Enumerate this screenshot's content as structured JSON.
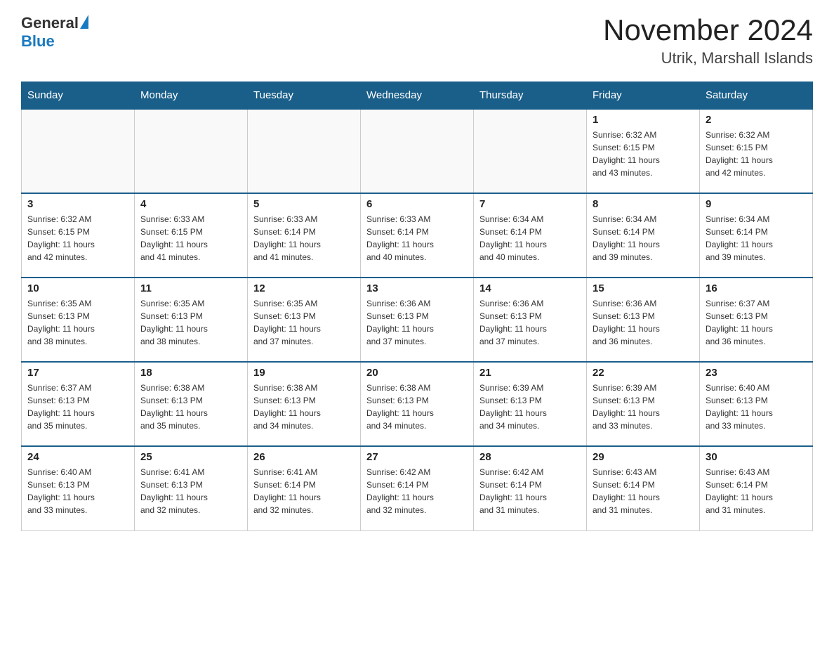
{
  "header": {
    "logo_general": "General",
    "logo_blue": "Blue",
    "title": "November 2024",
    "subtitle": "Utrik, Marshall Islands"
  },
  "days_of_week": [
    "Sunday",
    "Monday",
    "Tuesday",
    "Wednesday",
    "Thursday",
    "Friday",
    "Saturday"
  ],
  "weeks": [
    [
      {
        "day": "",
        "info": ""
      },
      {
        "day": "",
        "info": ""
      },
      {
        "day": "",
        "info": ""
      },
      {
        "day": "",
        "info": ""
      },
      {
        "day": "",
        "info": ""
      },
      {
        "day": "1",
        "info": "Sunrise: 6:32 AM\nSunset: 6:15 PM\nDaylight: 11 hours\nand 43 minutes."
      },
      {
        "day": "2",
        "info": "Sunrise: 6:32 AM\nSunset: 6:15 PM\nDaylight: 11 hours\nand 42 minutes."
      }
    ],
    [
      {
        "day": "3",
        "info": "Sunrise: 6:32 AM\nSunset: 6:15 PM\nDaylight: 11 hours\nand 42 minutes."
      },
      {
        "day": "4",
        "info": "Sunrise: 6:33 AM\nSunset: 6:15 PM\nDaylight: 11 hours\nand 41 minutes."
      },
      {
        "day": "5",
        "info": "Sunrise: 6:33 AM\nSunset: 6:14 PM\nDaylight: 11 hours\nand 41 minutes."
      },
      {
        "day": "6",
        "info": "Sunrise: 6:33 AM\nSunset: 6:14 PM\nDaylight: 11 hours\nand 40 minutes."
      },
      {
        "day": "7",
        "info": "Sunrise: 6:34 AM\nSunset: 6:14 PM\nDaylight: 11 hours\nand 40 minutes."
      },
      {
        "day": "8",
        "info": "Sunrise: 6:34 AM\nSunset: 6:14 PM\nDaylight: 11 hours\nand 39 minutes."
      },
      {
        "day": "9",
        "info": "Sunrise: 6:34 AM\nSunset: 6:14 PM\nDaylight: 11 hours\nand 39 minutes."
      }
    ],
    [
      {
        "day": "10",
        "info": "Sunrise: 6:35 AM\nSunset: 6:13 PM\nDaylight: 11 hours\nand 38 minutes."
      },
      {
        "day": "11",
        "info": "Sunrise: 6:35 AM\nSunset: 6:13 PM\nDaylight: 11 hours\nand 38 minutes."
      },
      {
        "day": "12",
        "info": "Sunrise: 6:35 AM\nSunset: 6:13 PM\nDaylight: 11 hours\nand 37 minutes."
      },
      {
        "day": "13",
        "info": "Sunrise: 6:36 AM\nSunset: 6:13 PM\nDaylight: 11 hours\nand 37 minutes."
      },
      {
        "day": "14",
        "info": "Sunrise: 6:36 AM\nSunset: 6:13 PM\nDaylight: 11 hours\nand 37 minutes."
      },
      {
        "day": "15",
        "info": "Sunrise: 6:36 AM\nSunset: 6:13 PM\nDaylight: 11 hours\nand 36 minutes."
      },
      {
        "day": "16",
        "info": "Sunrise: 6:37 AM\nSunset: 6:13 PM\nDaylight: 11 hours\nand 36 minutes."
      }
    ],
    [
      {
        "day": "17",
        "info": "Sunrise: 6:37 AM\nSunset: 6:13 PM\nDaylight: 11 hours\nand 35 minutes."
      },
      {
        "day": "18",
        "info": "Sunrise: 6:38 AM\nSunset: 6:13 PM\nDaylight: 11 hours\nand 35 minutes."
      },
      {
        "day": "19",
        "info": "Sunrise: 6:38 AM\nSunset: 6:13 PM\nDaylight: 11 hours\nand 34 minutes."
      },
      {
        "day": "20",
        "info": "Sunrise: 6:38 AM\nSunset: 6:13 PM\nDaylight: 11 hours\nand 34 minutes."
      },
      {
        "day": "21",
        "info": "Sunrise: 6:39 AM\nSunset: 6:13 PM\nDaylight: 11 hours\nand 34 minutes."
      },
      {
        "day": "22",
        "info": "Sunrise: 6:39 AM\nSunset: 6:13 PM\nDaylight: 11 hours\nand 33 minutes."
      },
      {
        "day": "23",
        "info": "Sunrise: 6:40 AM\nSunset: 6:13 PM\nDaylight: 11 hours\nand 33 minutes."
      }
    ],
    [
      {
        "day": "24",
        "info": "Sunrise: 6:40 AM\nSunset: 6:13 PM\nDaylight: 11 hours\nand 33 minutes."
      },
      {
        "day": "25",
        "info": "Sunrise: 6:41 AM\nSunset: 6:13 PM\nDaylight: 11 hours\nand 32 minutes."
      },
      {
        "day": "26",
        "info": "Sunrise: 6:41 AM\nSunset: 6:14 PM\nDaylight: 11 hours\nand 32 minutes."
      },
      {
        "day": "27",
        "info": "Sunrise: 6:42 AM\nSunset: 6:14 PM\nDaylight: 11 hours\nand 32 minutes."
      },
      {
        "day": "28",
        "info": "Sunrise: 6:42 AM\nSunset: 6:14 PM\nDaylight: 11 hours\nand 31 minutes."
      },
      {
        "day": "29",
        "info": "Sunrise: 6:43 AM\nSunset: 6:14 PM\nDaylight: 11 hours\nand 31 minutes."
      },
      {
        "day": "30",
        "info": "Sunrise: 6:43 AM\nSunset: 6:14 PM\nDaylight: 11 hours\nand 31 minutes."
      }
    ]
  ]
}
